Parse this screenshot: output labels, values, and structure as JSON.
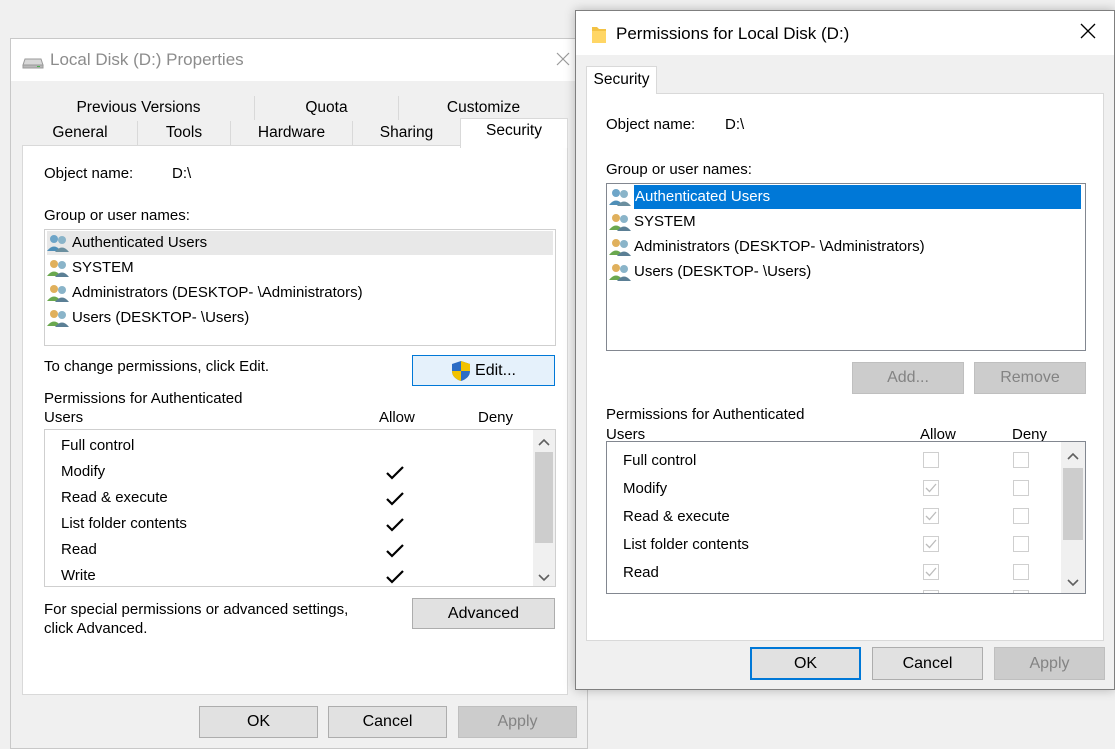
{
  "props": {
    "title": "Local Disk (D:) Properties",
    "tabs_row1": [
      "Previous Versions",
      "Quota",
      "Customize"
    ],
    "tabs_row2": [
      "General",
      "Tools",
      "Hardware",
      "Sharing",
      "Security"
    ],
    "object_label": "Object name:",
    "object_value": "D:\\",
    "group_label": "Group or user names:",
    "users": [
      {
        "name": "Authenticated Users"
      },
      {
        "name": "SYSTEM"
      },
      {
        "name": "Administrators (DESKTOP-                    \\Administrators)"
      },
      {
        "name": "Users (DESKTOP-                    \\Users)"
      }
    ],
    "change_text": "To change permissions, click Edit.",
    "edit_label": "Edit...",
    "perm_heading_1": "Permissions for Authenticated",
    "perm_heading_2": "Users",
    "allow_label": "Allow",
    "deny_label": "Deny",
    "permissions": [
      {
        "name": "Full control",
        "allow": false
      },
      {
        "name": "Modify",
        "allow": true
      },
      {
        "name": "Read & execute",
        "allow": true
      },
      {
        "name": "List folder contents",
        "allow": true
      },
      {
        "name": "Read",
        "allow": true
      },
      {
        "name": "Write",
        "allow": true
      }
    ],
    "special_text_1": "For special permissions or advanced settings,",
    "special_text_2": "click Advanced.",
    "advanced_label": "Advanced",
    "ok_label": "OK",
    "cancel_label": "Cancel",
    "apply_label": "Apply"
  },
  "perm": {
    "title": "Permissions for Local Disk (D:)",
    "tab": "Security",
    "object_label": "Object name:",
    "object_value": "D:\\",
    "group_label": "Group or user names:",
    "users": [
      {
        "name": "Authenticated Users"
      },
      {
        "name": "SYSTEM"
      },
      {
        "name": "Administrators (DESKTOP-                    \\Administrators)"
      },
      {
        "name": "Users (DESKTOP-                    \\Users)"
      }
    ],
    "add_label": "Add...",
    "remove_label": "Remove",
    "perm_heading_1": "Permissions for Authenticated",
    "perm_heading_2": "Users",
    "allow_label": "Allow",
    "deny_label": "Deny",
    "permissions": [
      {
        "name": "Full control",
        "allow": false,
        "deny": false
      },
      {
        "name": "Modify",
        "allow": true,
        "deny": false
      },
      {
        "name": "Read & execute",
        "allow": true,
        "deny": false
      },
      {
        "name": "List folder contents",
        "allow": true,
        "deny": false
      },
      {
        "name": "Read",
        "allow": true,
        "deny": false
      }
    ],
    "ok_label": "OK",
    "cancel_label": "Cancel",
    "apply_label": "Apply"
  },
  "colors": {
    "selection": "#0078d7",
    "dialog_bg": "#f0f0f0"
  }
}
